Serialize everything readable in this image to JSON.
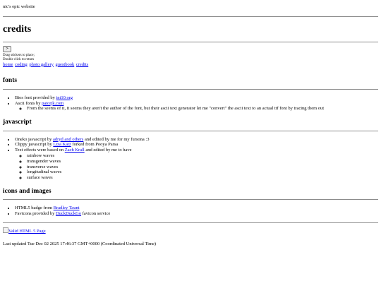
{
  "site": {
    "title": "nic's epic website"
  },
  "page": {
    "heading": "credits"
  },
  "stickers": {
    "button_label": ">",
    "hint_line1": "Drag stickers to place;",
    "hint_line2": "Double click to return"
  },
  "nav": {
    "items": [
      {
        "label": "home"
      },
      {
        "label": "coding"
      },
      {
        "label": "photo gallery"
      },
      {
        "label": "guestbook"
      },
      {
        "label": "credits"
      }
    ]
  },
  "fonts": {
    "heading": "fonts",
    "item1": {
      "pre": "Bios font provided by ",
      "link": "int10.org",
      "post": ""
    },
    "item2": {
      "pre": "Ascii fonts by ",
      "link": "patorjk.com",
      "post": ""
    },
    "note": "From the seems of it, it seems they aren't the author of the font, but their ascii text generator let me \"convert\" the ascii text to an actual ttf font by tracing them out"
  },
  "javascript": {
    "heading": "javascript",
    "item1": {
      "pre": "Oneko javascript by ",
      "link": "adryd and others",
      "post": " and edited by me for my fursona :3"
    },
    "item2": {
      "pre": "Clippy javascript by ",
      "link": "Liza Katz",
      "post": " forked from Pooya Parsa"
    },
    "item3": {
      "pre": "Text effects were based on ",
      "link": "Zach Krall",
      "post": " and edited by me to have"
    },
    "effects": [
      "rainbow waves",
      "transgender waves",
      "transverse waves",
      "longitudinal waves",
      "surface waves"
    ]
  },
  "icons": {
    "heading": "icons and images",
    "item1": {
      "pre": "HTML5 badge from ",
      "link": "Bradley Taunt",
      "post": ""
    },
    "item2": {
      "pre": "Favicons provided by ",
      "link": "DuckDuckGo",
      "post": " favicon service"
    }
  },
  "footer": {
    "badge_alt": "Valid HTML 5 Page",
    "last_updated": "Last updated Tue Dec 02 2025 17:46:37 GMT+0000 (Coordinated Universal Time)"
  }
}
